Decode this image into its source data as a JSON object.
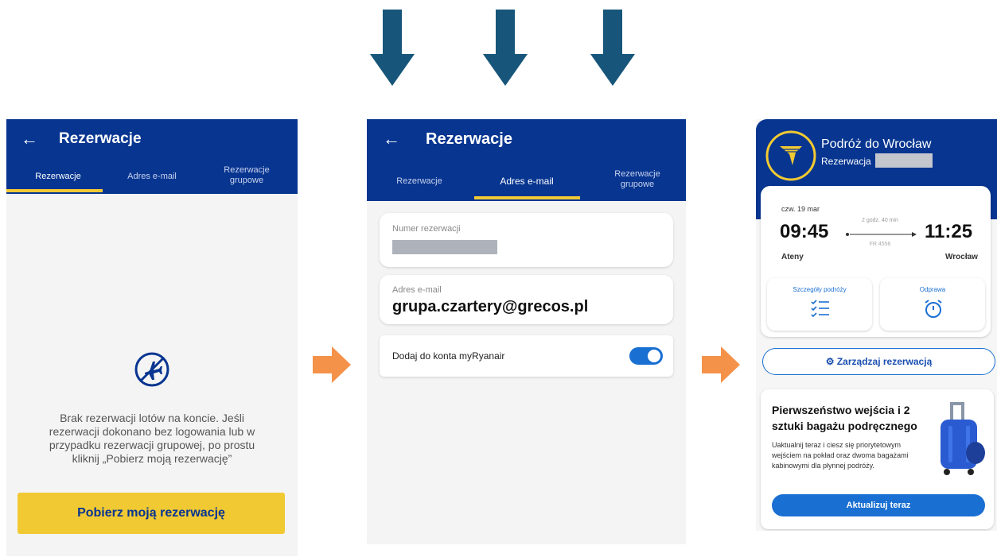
{
  "colors": {
    "header_blue": "#073590",
    "yellow": "#f1c933",
    "arrow_down": "#17567a",
    "arrow_right": "#f4924a",
    "accent_blue": "#1a6fd2"
  },
  "screen1": {
    "title": "Rezerwacje",
    "tabs": [
      "Rezerwacje",
      "Adres e-mail",
      "Rezerwacje grupowe"
    ],
    "active_tab": 0,
    "empty_icon": "no-flights-icon",
    "empty_message": "Brak rezerwacji lotów na koncie. Jeśli rezerwacji dokonano bez logowania lub w przypadku rezerwacji grupowej, po prostu kliknij „Pobierz moją rezerwację”",
    "button_label": "Pobierz moją rezerwację"
  },
  "screen2": {
    "title": "Rezerwacje",
    "tabs": [
      "Rezerwacje",
      "Adres e-mail",
      "Rezerwacje grupowe"
    ],
    "active_tab": 1,
    "booking_number_label": "Numer rezerwacji",
    "email_label": "Adres e-mail",
    "email_value": "grupa.czartery@grecos.pl",
    "toggle_label": "Dodaj do konta myRyanair",
    "toggle_on": true
  },
  "screen3": {
    "trip_title": "Podróż do Wrocław",
    "booking_prefix": "Rezerwacja",
    "date": "czw. 19 mar",
    "depart_time": "09:45",
    "arrive_time": "11:25",
    "duration": "2 godz. 40 min",
    "flight_no": "FR 4556",
    "origin": "Ateny",
    "destination": "Wrocław",
    "details_label": "Szczegóły podróży",
    "checkin_label": "Odprawa",
    "manage_label": "Zarządzaj rezerwacją",
    "promo_title": "Pierwszeństwo wejścia i 2 sztuki bagażu podręcznego",
    "promo_text": "Uaktualnij teraz i ciesz się priorytetowym wejściem na pokład oraz dwoma bagażami kabinowymi dla płynnej podróży.",
    "promo_button": "Aktualizuj teraz"
  }
}
